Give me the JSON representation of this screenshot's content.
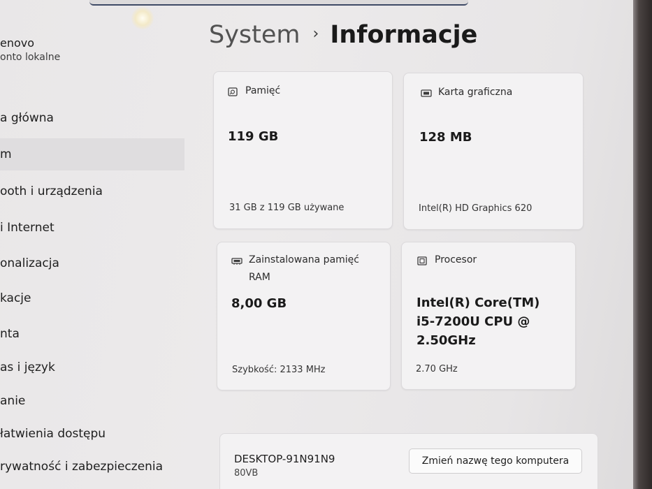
{
  "account": {
    "name": "enovo",
    "type": "onto lokalne"
  },
  "nav": {
    "items": [
      {
        "label": "a główna"
      },
      {
        "label": "m"
      },
      {
        "label": "ooth i urządzenia"
      },
      {
        "label": "i Internet"
      },
      {
        "label": "onalizacja"
      },
      {
        "label": "kacje"
      },
      {
        "label": "nta"
      },
      {
        "label": "as i język"
      },
      {
        "label": "anie"
      },
      {
        "label": "łatwienia dostępu"
      },
      {
        "label": "rywatność i zabezpieczenia"
      }
    ],
    "selected_index": 1
  },
  "header": {
    "parent": "System",
    "separator": "›",
    "current": "Informacje"
  },
  "cards": {
    "storage": {
      "icon": "storage-icon",
      "title": "Pamięć",
      "value": "119 GB",
      "sub": "31 GB z 119 GB używane"
    },
    "gpu": {
      "icon": "gpu-icon",
      "title": "Karta graficzna",
      "value": "128 MB",
      "sub": "Intel(R) HD Graphics 620"
    },
    "ram": {
      "icon": "ram-icon",
      "title_line1": "Zainstalowana pamięć",
      "title_line2": "RAM",
      "value": "8,00 GB",
      "sub": "Szybkość: 2133 MHz"
    },
    "cpu": {
      "icon": "cpu-icon",
      "title": "Procesor",
      "value_line1": "Intel(R) Core(TM)",
      "value_line2": "i5-7200U CPU @",
      "value_line3": "2.50GHz",
      "sub": "2.70 GHz"
    }
  },
  "device": {
    "name": "DESKTOP-91N91N9",
    "model": "80VB",
    "rename_label": "Zmień nazwę tego komputera"
  }
}
